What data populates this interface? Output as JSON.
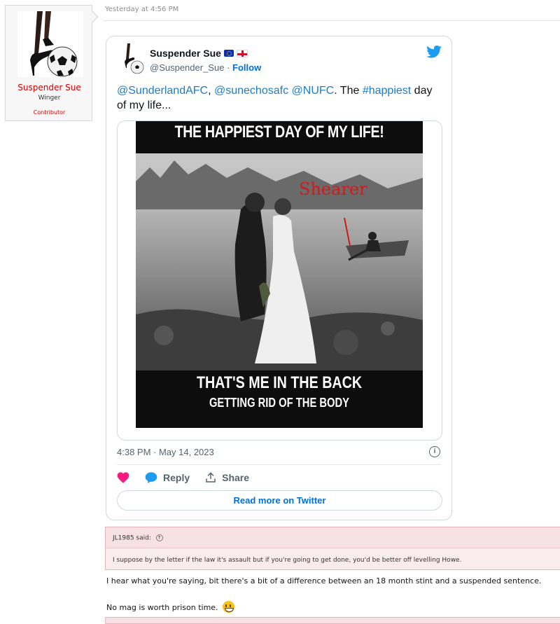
{
  "user": {
    "name": "Suspender Sue",
    "title": "Winger",
    "banner": "Contributor"
  },
  "post": {
    "time": "Yesterday at 4:56 PM"
  },
  "tweet": {
    "display_name": "Suspender Sue",
    "handle": "@Suspender_Sue",
    "separator": "·",
    "follow": "Follow",
    "text": {
      "mention1": "@SunderlandAFC",
      "comma1": ", ",
      "mention2": "@sunechosafc",
      "space1": " ",
      "mention3": "@NUFC",
      "plain1": ". The ",
      "hashtag": "#happiest",
      "plain2": " day of my life..."
    },
    "image": {
      "top_caption": "THE HAPPIEST DAY OF MY LIFE!",
      "label": "Shearer",
      "bottom_caption_1": "THAT'S ME IN THE BACK",
      "bottom_caption_2": "GETTING RID OF THE BODY"
    },
    "date": "4:38 PM · May 14, 2023",
    "info_icon": "i",
    "actions": {
      "reply": "Reply",
      "share": "Share"
    },
    "read_more": "Read more on Twitter",
    "colors": {
      "link": "#1d7cc4",
      "heart": "#f91880",
      "brand": "#1d9bf0"
    }
  },
  "quote": {
    "author": "JL1985 said:",
    "text": "I suppose by the letter if the law it's assault but if you're going to get done, you'd be better off levelling Howe."
  },
  "reply": {
    "line1": "I hear what you're saying, bit there's a bit of a difference between an 18 month stint and a suspended sentence.",
    "line2": "No mag is worth prison time."
  }
}
